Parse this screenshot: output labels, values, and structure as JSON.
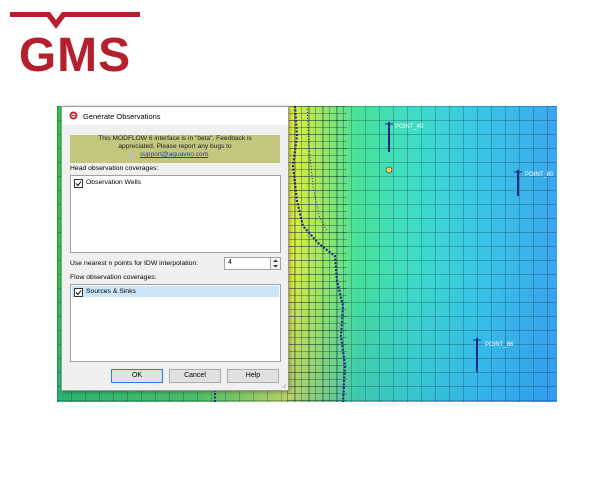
{
  "logo": {
    "text": "GMS",
    "color": "#b5202e"
  },
  "map": {
    "wells": [
      {
        "label": "POINT_40"
      },
      {
        "label": "POINT_80"
      },
      {
        "label": "POINT_86"
      }
    ]
  },
  "dialog": {
    "title": "Generate Observations",
    "beta_line1": "This MODFLOW 6 interface is in \"beta\". Feedback is",
    "beta_line2": "appreciated. Please report any bugs to",
    "beta_link": "support@aquaveo.com",
    "beta_link_suffix": ".",
    "head_label": "Head observation coverages:",
    "head_items": [
      {
        "label": "Observation Wells",
        "checked": true
      }
    ],
    "idw_label": "Use nearest n points for IDW interpolation:",
    "idw_value": "4",
    "flow_label": "Flow observation coverages:",
    "flow_items": [
      {
        "label": "Sources & Sinks",
        "checked": true,
        "selected": true
      }
    ],
    "ok_label": "OK",
    "cancel_label": "Cancel",
    "help_label": "Help"
  },
  "colors": {
    "beta_banner": "#c3c77e",
    "link": "#1a3fc0",
    "selection": "#cce4f7"
  }
}
